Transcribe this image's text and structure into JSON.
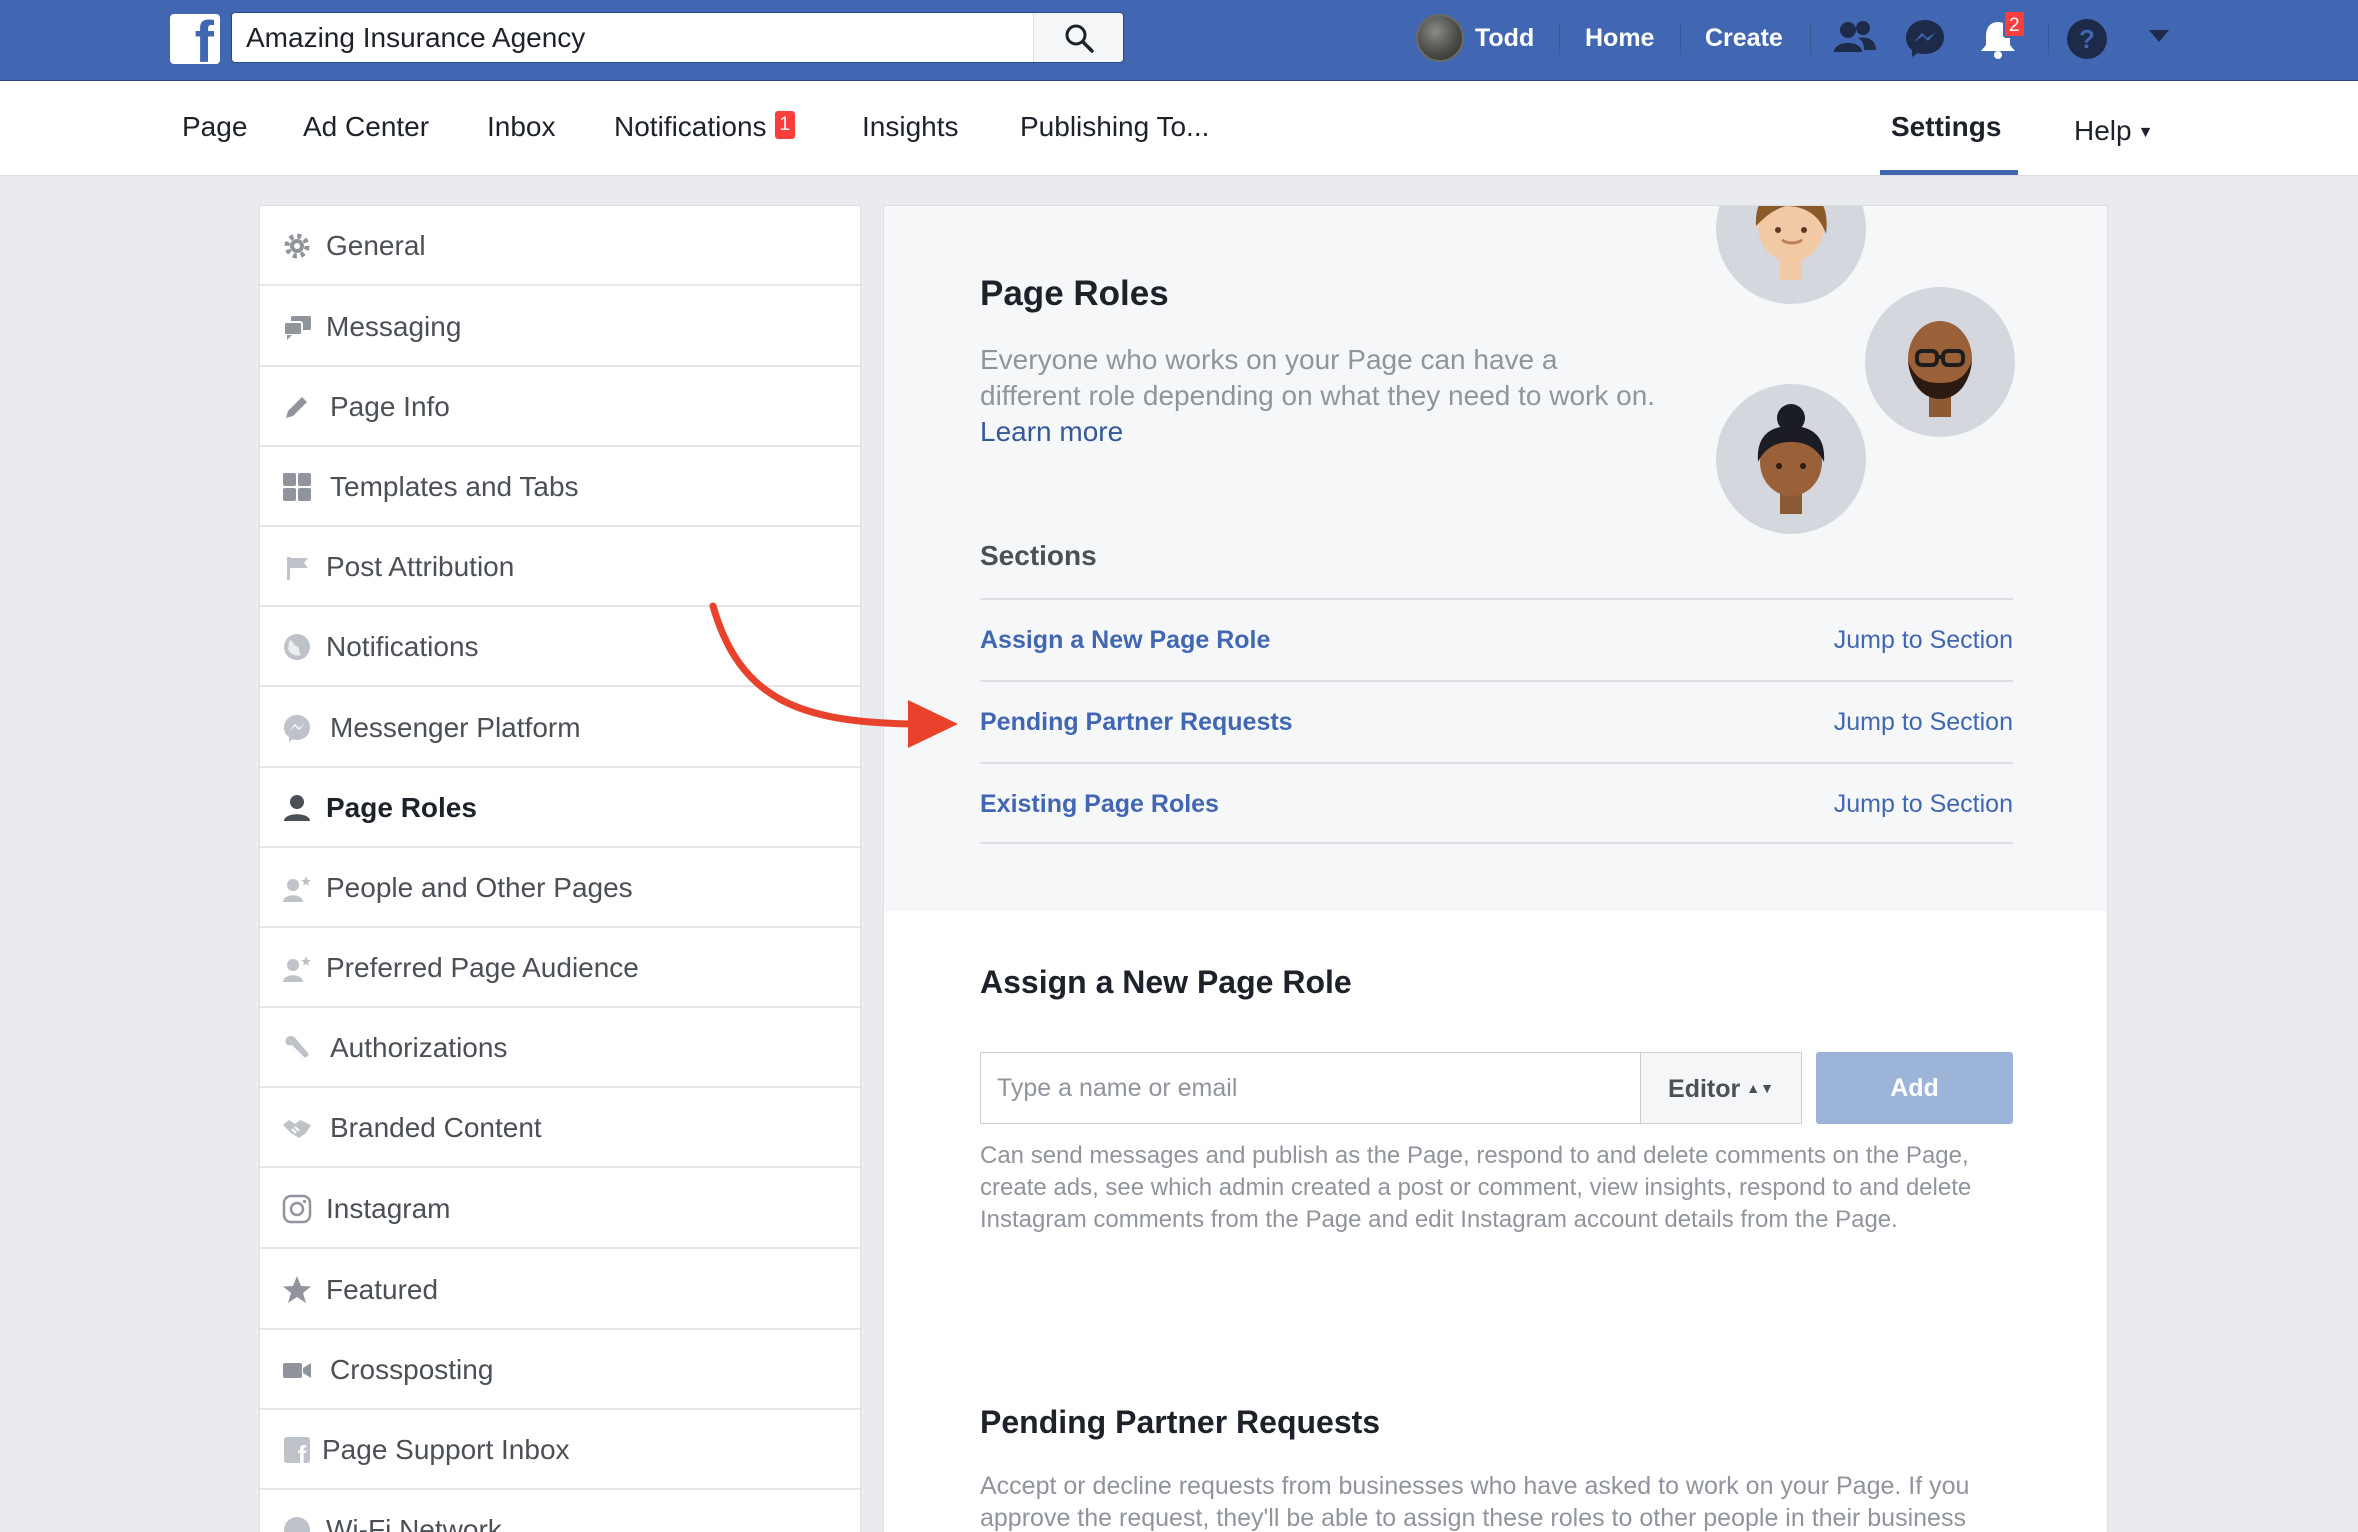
{
  "topbar": {
    "search_value": "Amazing Insurance Agency",
    "user_name": "Todd",
    "home_label": "Home",
    "create_label": "Create",
    "notification_count": "2",
    "brand_color": "#4267b2"
  },
  "subnav": {
    "items": [
      "Page",
      "Ad Center",
      "Inbox",
      "Notifications",
      "Insights",
      "Publishing To..."
    ],
    "notifications_badge": "1",
    "settings_label": "Settings",
    "help_label": "Help"
  },
  "sidebar": {
    "active": "Page Roles",
    "items": [
      {
        "label": "General",
        "icon": "gear-icon"
      },
      {
        "label": "Messaging",
        "icon": "messaging-icon"
      },
      {
        "label": "Page Info",
        "icon": "pencil-icon"
      },
      {
        "label": "Templates and Tabs",
        "icon": "grid-icon"
      },
      {
        "label": "Post Attribution",
        "icon": "flag-icon"
      },
      {
        "label": "Notifications",
        "icon": "globe-icon"
      },
      {
        "label": "Messenger Platform",
        "icon": "messenger-icon"
      },
      {
        "label": "Page Roles",
        "icon": "person-icon"
      },
      {
        "label": "People and Other Pages",
        "icon": "people-star-icon"
      },
      {
        "label": "Preferred Page Audience",
        "icon": "people-star-icon"
      },
      {
        "label": "Authorizations",
        "icon": "wrench-icon"
      },
      {
        "label": "Branded Content",
        "icon": "handshake-icon"
      },
      {
        "label": "Instagram",
        "icon": "instagram-icon"
      },
      {
        "label": "Featured",
        "icon": "star-icon"
      },
      {
        "label": "Crossposting",
        "icon": "video-camera-icon"
      },
      {
        "label": "Page Support Inbox",
        "icon": "facebook-square-icon"
      },
      {
        "label": "Wi-Fi Network",
        "icon": "wifi-icon"
      }
    ]
  },
  "page_roles": {
    "title": "Page Roles",
    "intro": "Everyone who works on your Page can have a different role depending on what they need to work on.",
    "learn_more": "Learn more",
    "sections_heading": "Sections",
    "sections": [
      {
        "title": "Assign a New Page Role",
        "jump": "Jump to Section"
      },
      {
        "title": "Pending Partner Requests",
        "jump": "Jump to Section"
      },
      {
        "title": "Existing Page Roles",
        "jump": "Jump to Section"
      }
    ]
  },
  "assign_role": {
    "title": "Assign a New Page Role",
    "input_placeholder": "Type a name or email",
    "role_selected": "Editor",
    "add_label": "Add",
    "description": "Can send messages and publish as the Page, respond to and delete comments on the Page, create ads, see which admin created a post or comment, view insights, respond to and delete Instagram comments from the Page and edit Instagram account details from the Page."
  },
  "pending": {
    "title": "Pending Partner Requests",
    "description": "Accept or decline requests from businesses who have asked to work on your Page. If you approve the request, they'll be able to assign these roles to other people in their business"
  },
  "annotation": {
    "arrow_color": "#e8412c"
  }
}
